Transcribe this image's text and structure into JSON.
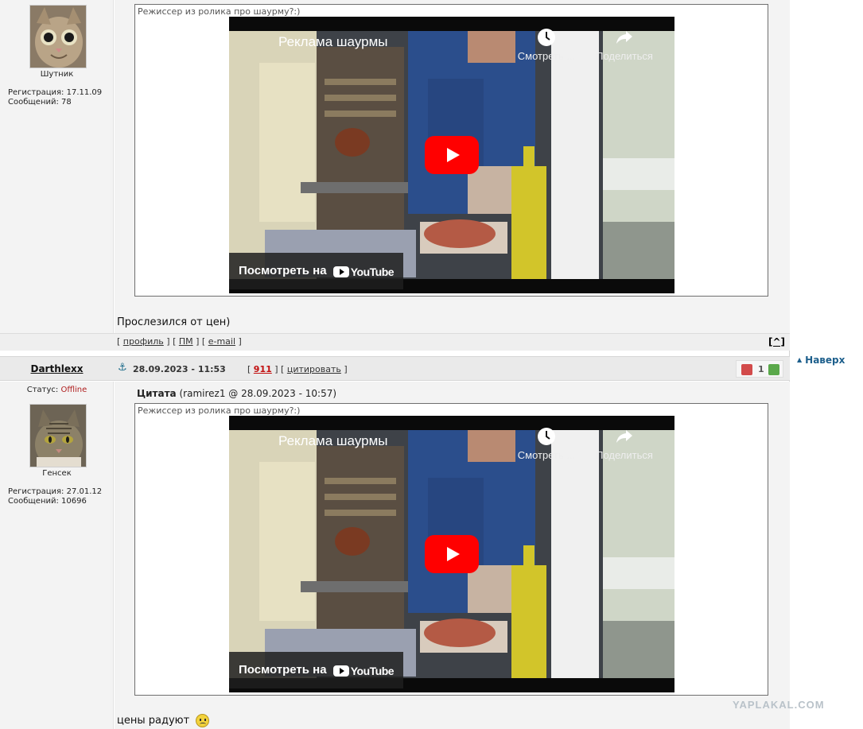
{
  "post1": {
    "user_group": "Шутник",
    "registration": "Регистрация: 17.11.09",
    "messages": "Сообщений: 78",
    "quote_caption": "Режиссер из ролика про шаурму?:)",
    "video": {
      "title": "Реклама шаурмы",
      "watch_later": "Смотреть ...",
      "share": "Поделиться",
      "watch_on": "Посмотреть на",
      "youtube": "YouTube"
    },
    "text": "Прослезился от цен)",
    "links": {
      "profile": "профиль",
      "pm": "ПМ",
      "email": "e-mail",
      "to_top": "[^]"
    }
  },
  "post2": {
    "username": "Darthlexx",
    "date": "28.09.2023 - 11:53",
    "post_number": "911",
    "quote_link": "цитировать",
    "rating_value": "1",
    "status_label": "Статус:",
    "status_value": "Offline",
    "user_group": "Генсек",
    "registration": "Регистрация: 27.01.12",
    "messages": "Сообщений: 10696",
    "quote_label": "Цитата",
    "quote_source": "(ramirez1 @ 28.09.2023 - 10:57)",
    "quote_caption": "Режиссер из ролика про шаурму?:)",
    "video": {
      "title": "Реклама шаурмы",
      "watch_later": "Смотреть ...",
      "share": "Поделиться",
      "watch_on": "Посмотреть на",
      "youtube": "YouTube"
    },
    "text": "цены радуют"
  },
  "sidebar": {
    "back_to_top": "Наверх"
  },
  "watermark": "YAPLAKAL.COM",
  "colors": {
    "accent": "#1d5f8c",
    "offline": "#b02020",
    "post_number": "#c21010",
    "youtube_red": "#ff0000"
  }
}
